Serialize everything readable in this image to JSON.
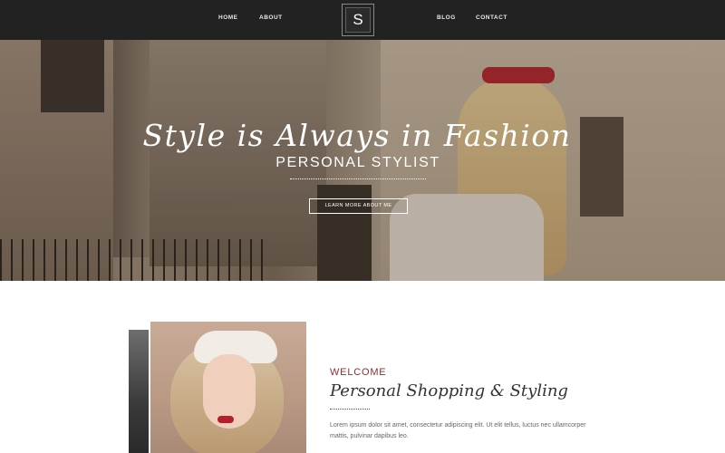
{
  "nav": {
    "links": [
      "HOME",
      "ABOUT",
      "BLOG",
      "CONTACT"
    ],
    "logo_letter": "S",
    "background": "#222222"
  },
  "hero": {
    "title": "Style is Always in Fashion",
    "subtitle": "PERSONAL STYLIST",
    "button_label": "LEARN MORE ABOUT ME"
  },
  "welcome": {
    "eyebrow": "WELCOME",
    "title": "Personal Shopping & Styling",
    "body": "Lorem ipsum dolor sit amet, consectetur adipiscing elit. Ut elit tellus, luctus nec ullamcorper mattis, pulvinar dapibus leo.",
    "accent_color": "#8b2f2f"
  }
}
